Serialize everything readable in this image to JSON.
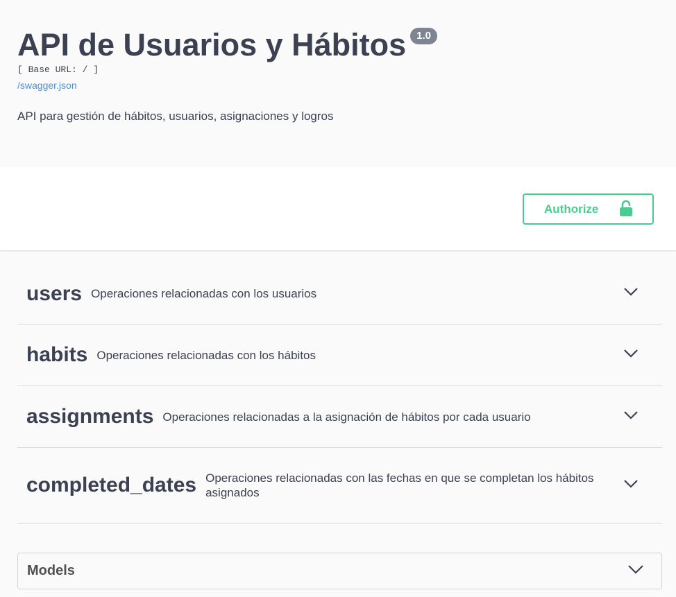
{
  "info": {
    "title": "API de Usuarios y Hábitos",
    "version": "1.0",
    "base_url": "[ Base URL: / ]",
    "spec_link": "/swagger.json",
    "description": "API para gestión de hábitos, usuarios, asignaciones y logros"
  },
  "auth": {
    "authorize_label": "Authorize",
    "icon": "unlocked-padlock-icon"
  },
  "tags": [
    {
      "name": "users",
      "description": "Operaciones relacionadas con los usuarios"
    },
    {
      "name": "habits",
      "description": "Operaciones relacionadas con los hábitos"
    },
    {
      "name": "assignments",
      "description": "Operaciones relacionadas a la asignación de hábitos por cada usuario"
    },
    {
      "name": "completed_dates",
      "description": "Operaciones relacionadas con las fechas en que se completan los hábitos asignados"
    }
  ],
  "models": {
    "title": "Models"
  },
  "colors": {
    "accent_green": "#49cc90",
    "version_badge": "#7d8492",
    "link": "#4990e2",
    "text": "#3b4151"
  }
}
